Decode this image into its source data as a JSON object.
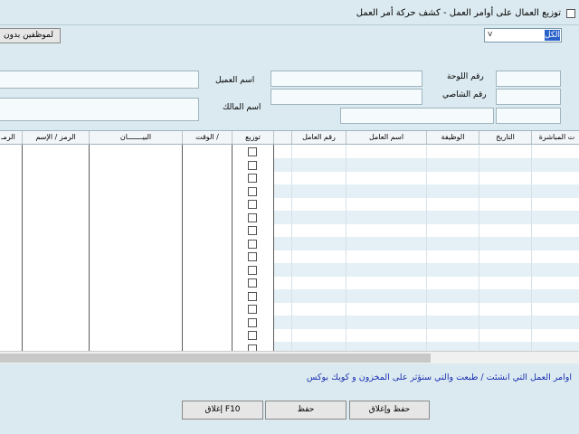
{
  "window": {
    "title": "توزيع العمال على أوامر العمل - كشف حركة أمر العمل"
  },
  "toolbar": {
    "employees_button": "لموظفين بدون",
    "filter_value": "الكل",
    "filter_arrow": "v"
  },
  "form": {
    "plate_label": "رقم اللوحة",
    "chassis_label": "رقم الشاصي",
    "client_label": "اسم العميل",
    "owner_label": "اسم المالك"
  },
  "grid": {
    "right_columns": [
      "ت المباشرة",
      "التاريخ",
      "الوظيفة",
      "اسم العامل",
      "رقم العامل"
    ],
    "left_columns": [
      "توزيع",
      "الوقت /",
      "البيـــــــان",
      "الرمز / الإسم",
      "الرمـ"
    ],
    "checkbox_count": 17
  },
  "footer": {
    "note": "اوامر العمل التي انشئت / طبعت والتي ستؤثر على المخزون و كويك بوكس",
    "save_close_button": "حفظ وإغلاق",
    "save_button": "حفظ",
    "close_button": "إغلاق F10"
  }
}
